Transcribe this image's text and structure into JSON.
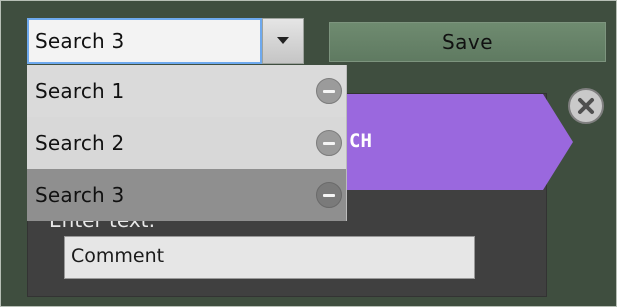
{
  "search_combo": {
    "value": "Search 3",
    "options": [
      "Search 1",
      "Search 2",
      "Search 3"
    ],
    "selected_index": 2
  },
  "toolbar": {
    "save_label": "Save"
  },
  "canvas": {
    "purple_block_label": "CH",
    "enter_label": "Enter text:",
    "comment_value": "Comment"
  },
  "colors": {
    "background": "#3f4e3f",
    "accent_purple": "#9a68de",
    "dropdown_selected": "#8f8f8f"
  },
  "icons": {
    "dropdown": "chevron-down-icon",
    "remove": "minus-circle-icon",
    "close": "close-circle-icon"
  }
}
